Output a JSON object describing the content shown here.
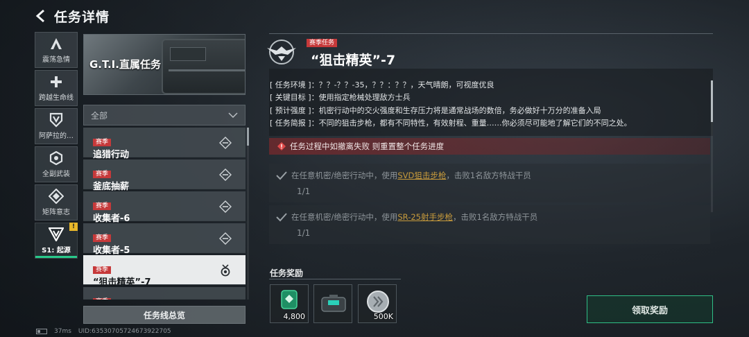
{
  "header": {
    "title": "任务详情"
  },
  "rail": {
    "items": [
      {
        "label": "震荡急情",
        "icon": "a-chevron-icon"
      },
      {
        "label": "跨越生命线",
        "icon": "medical-cross-icon"
      },
      {
        "label": "阿萨拉的…",
        "icon": "shield-v-icon"
      },
      {
        "label": "全副武装",
        "icon": "hex-gear-icon"
      },
      {
        "label": "矩阵意志",
        "icon": "diamond-arrows-icon"
      },
      {
        "label": "S1: 起源",
        "icon": "triangle-v-icon",
        "active": true,
        "badge": "!"
      }
    ]
  },
  "banner": {
    "title": "G.T.I.直属任务"
  },
  "filter": {
    "selected": "全部"
  },
  "task_list": [
    {
      "tag": "赛季",
      "name": "追猎行动",
      "status": "locked-icon"
    },
    {
      "tag": "赛季",
      "name": "釜底抽薪",
      "status": "locked-icon"
    },
    {
      "tag": "赛季",
      "name": "收集者-6",
      "status": "locked-icon"
    },
    {
      "tag": "赛季",
      "name": "收集者-5",
      "status": "locked-icon"
    },
    {
      "tag": "赛季",
      "name": "“狙击精英”-7",
      "status": "medal-icon",
      "selected": true
    },
    {
      "tag": "赛季",
      "name": ""
    }
  ],
  "overview_button": "任务线总览",
  "footer": {
    "ping": "37ms",
    "uid": "UID:635307057246739227​05"
  },
  "detail": {
    "tag": "赛季任务",
    "title": "“狙击精英”-7",
    "info": [
      {
        "key": "[ 任务环境 ]：",
        "value": "？？-？？-35，？？：？？，天气晴朗，可视度优良"
      },
      {
        "key": "[ 关键目标 ]：",
        "value": "使用指定枪械处理敌方士兵"
      },
      {
        "key": "[ 预计强度 ]：",
        "value": "机密行动中的交火强度和生存压力将是通常战场的数倍，务必做好十万分的准备入局"
      },
      {
        "key": "[ 任务简报 ]：",
        "value": "不同的狙击步枪，都有不同特性，有效射程、重量……你必须尽可能地了解它们的不同之处。"
      }
    ],
    "warning": "任务过程中如撤离失败 则重置整个任务进度",
    "objectives": [
      {
        "pre": "在任意机密/绝密行动中，使用",
        "weapon": "SVD狙击步枪",
        "post": "，击败1名敌方特战干员",
        "progress": "1/1"
      },
      {
        "pre": "在任意机密/绝密行动中，使用",
        "weapon": "SR-25射手步枪",
        "post": "，击败1名敌方特战干员",
        "progress": "1/1"
      }
    ],
    "rewards_label": "任务奖励",
    "rewards": [
      {
        "item": "green-currency-icon",
        "amount": "4,800"
      },
      {
        "item": "equipment-case-icon",
        "amount": ""
      },
      {
        "item": "silver-coin-icon",
        "amount": "500K"
      }
    ],
    "claim_button": "领取奖励"
  },
  "colors": {
    "accent": "#28c98a",
    "tag_red": "#c6393a",
    "highlight": "#c89b3c"
  }
}
